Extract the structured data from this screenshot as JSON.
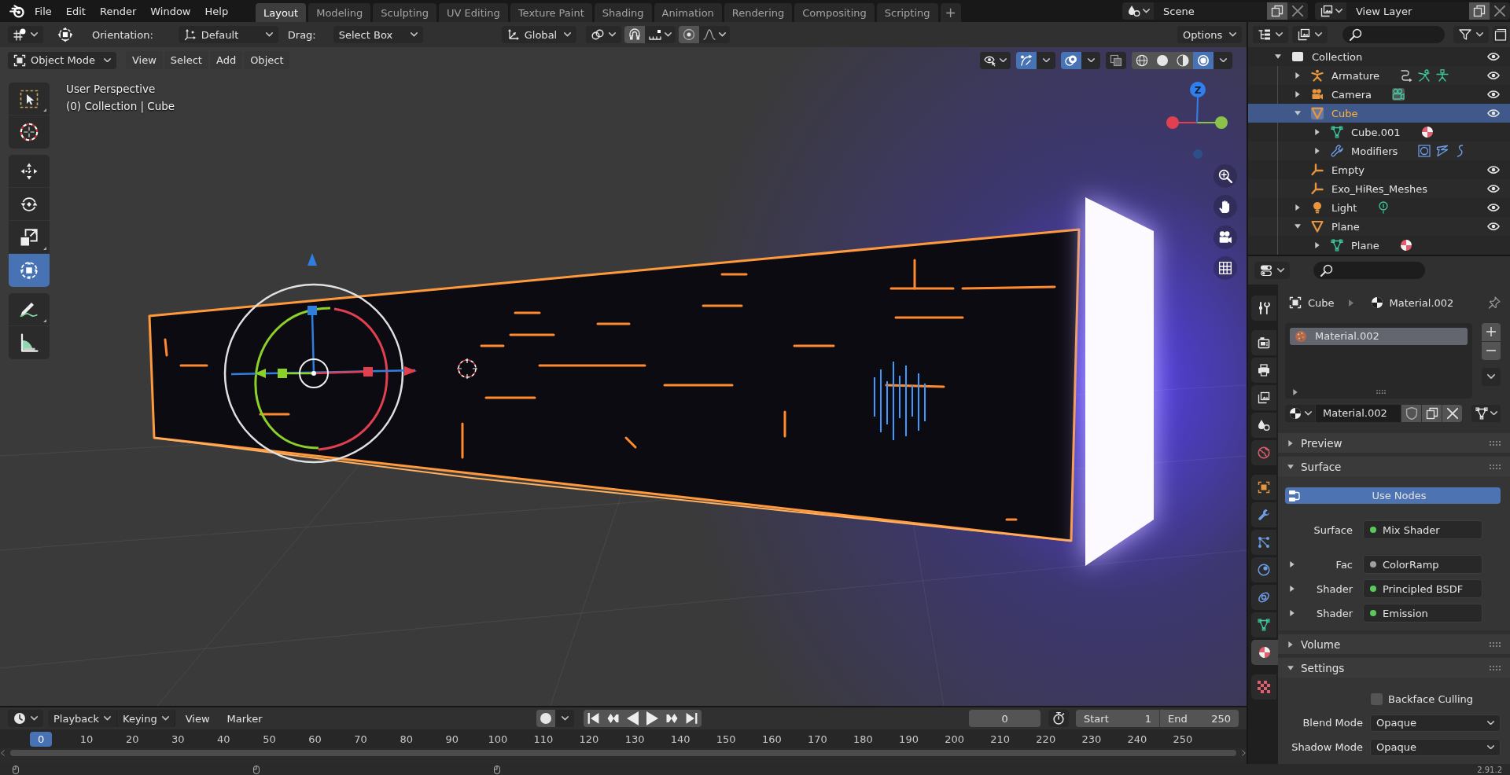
{
  "topbar": {
    "menus": [
      "File",
      "Edit",
      "Render",
      "Window",
      "Help"
    ],
    "workspaces": [
      {
        "label": "Layout",
        "selected": true
      },
      {
        "label": "Modeling",
        "selected": false
      },
      {
        "label": "Sculpting",
        "selected": false
      },
      {
        "label": "UV Editing",
        "selected": false
      },
      {
        "label": "Texture Paint",
        "selected": false
      },
      {
        "label": "Shading",
        "selected": false
      },
      {
        "label": "Animation",
        "selected": false
      },
      {
        "label": "Rendering",
        "selected": false
      },
      {
        "label": "Compositing",
        "selected": false
      },
      {
        "label": "Scripting",
        "selected": false
      }
    ],
    "add_workspace": "+",
    "scene": "Scene",
    "view_layer": "View Layer"
  },
  "tool_settings": {
    "orientation_label": "Orientation:",
    "orientation": "Default",
    "drag_label": "Drag:",
    "drag": "Select Box",
    "transform_orientation": "Global",
    "snap": false,
    "proportional_editing": false,
    "options": "Options"
  },
  "viewport": {
    "mode": "Object Mode",
    "menus": [
      "View",
      "Select",
      "Add",
      "Object"
    ],
    "show_gizmos": true,
    "show_overlays": true,
    "xray": false,
    "shading": [
      {
        "kind": "wireframe",
        "selected": false
      },
      {
        "kind": "solid",
        "selected": false
      },
      {
        "kind": "material",
        "selected": false
      },
      {
        "kind": "rendered",
        "selected": true
      }
    ],
    "tool_groups": [
      {
        "tools": [
          {
            "kind": "select-box",
            "selected": false
          },
          {
            "kind": "cursor",
            "selected": false
          }
        ]
      },
      {
        "tools": [
          {
            "kind": "move",
            "selected": false
          },
          {
            "kind": "rotate",
            "selected": false
          },
          {
            "kind": "scale",
            "selected": false
          },
          {
            "kind": "transform",
            "selected": true
          }
        ]
      },
      {
        "tools": [
          {
            "kind": "annotate",
            "selected": false
          },
          {
            "kind": "measure",
            "selected": false
          }
        ]
      }
    ],
    "view_name": "User Perspective",
    "context": "(0) Collection | Cube",
    "nav_axis_label": "Z"
  },
  "outliner": {
    "tree": [
      {
        "label": "Collection",
        "kind": "collection",
        "expanded": true,
        "selected": false,
        "visible": true,
        "children": [
          {
            "label": "Armature",
            "kind": "armature",
            "expanded": false,
            "selected": false,
            "visible": true
          },
          {
            "label": "Camera",
            "kind": "camera",
            "expanded": false,
            "selected": false,
            "visible": true
          },
          {
            "label": "Cube",
            "kind": "mesh-object",
            "expanded": true,
            "selected": true,
            "visible": true,
            "children": [
              {
                "label": "Cube.001",
                "kind": "mesh-data",
                "expanded": false,
                "selected": false
              },
              {
                "label": "Modifiers",
                "kind": "modifiers",
                "expanded": false,
                "selected": false
              }
            ]
          },
          {
            "label": "Empty",
            "kind": "empty",
            "selected": false,
            "visible": true
          },
          {
            "label": "Exo_HiRes_Meshes",
            "kind": "empty",
            "selected": false,
            "visible": true
          },
          {
            "label": "Light",
            "kind": "light",
            "expanded": false,
            "selected": false,
            "visible": true
          },
          {
            "label": "Plane",
            "kind": "mesh-object",
            "expanded": true,
            "selected": false,
            "visible": true,
            "children": [
              {
                "label": "Plane",
                "kind": "mesh-data",
                "expanded": false,
                "selected": false
              }
            ]
          }
        ]
      }
    ]
  },
  "properties": {
    "tab_groups": [
      {
        "tabs": [
          {
            "kind": "tool",
            "selected": false
          }
        ]
      },
      {
        "tabs": [
          {
            "kind": "render",
            "selected": false
          },
          {
            "kind": "output",
            "selected": false
          },
          {
            "kind": "view-layer",
            "selected": false
          },
          {
            "kind": "scene",
            "selected": false
          },
          {
            "kind": "world",
            "selected": false
          }
        ]
      },
      {
        "tabs": [
          {
            "kind": "object",
            "selected": false
          },
          {
            "kind": "modifiers",
            "selected": false
          },
          {
            "kind": "particles",
            "selected": false
          },
          {
            "kind": "physics",
            "selected": false
          },
          {
            "kind": "constraints",
            "selected": false
          },
          {
            "kind": "data",
            "selected": false
          },
          {
            "kind": "material",
            "selected": true
          }
        ]
      },
      {
        "tabs": [
          {
            "kind": "texture",
            "selected": false
          }
        ]
      }
    ],
    "context_path": [
      {
        "kind": "object",
        "label": "Cube"
      },
      {
        "kind": "material",
        "label": "Material.002"
      }
    ],
    "material_slots": [
      {
        "label": "Material.002",
        "selected": true
      }
    ],
    "material_name": "Material.002",
    "panels": [
      {
        "title": "Preview",
        "expanded": false
      },
      {
        "title": "Surface",
        "expanded": true,
        "rows": [
          {
            "kind": "toggle-button",
            "label": "Use Nodes",
            "on": true
          },
          {
            "kind": "socket",
            "label": "Surface",
            "value": "Mix Shader",
            "color": "#5cc85c"
          },
          {
            "kind": "socket",
            "label": "Fac",
            "value": "ColorRamp",
            "color": "#a1a1a1",
            "expanded": false
          },
          {
            "kind": "socket",
            "label": "Shader",
            "value": "Principled BSDF",
            "color": "#5cc85c",
            "expanded": false
          },
          {
            "kind": "socket",
            "label": "Shader",
            "value": "Emission",
            "color": "#5cc85c",
            "expanded": false
          }
        ]
      },
      {
        "title": "Volume",
        "expanded": false
      },
      {
        "title": "Settings",
        "expanded": true,
        "rows": [
          {
            "kind": "checkbox",
            "label": "Backface Culling",
            "checked": false
          },
          {
            "kind": "dropdown",
            "label": "Blend Mode",
            "value": "Opaque"
          },
          {
            "kind": "dropdown",
            "label": "Shadow Mode",
            "value": "Opaque"
          }
        ]
      }
    ]
  },
  "timeline": {
    "menus": [
      {
        "label": "Playback",
        "kind": "dropdown"
      },
      {
        "label": "Keying",
        "kind": "dropdown"
      },
      {
        "label": "View",
        "kind": "menu"
      },
      {
        "label": "Marker",
        "kind": "menu"
      }
    ],
    "auto_keying": false,
    "current_frame": "0",
    "use_preview_range": false,
    "start_label": "Start",
    "start": "1",
    "end_label": "End",
    "end": "250",
    "ruler": [
      {
        "label": "0",
        "selected": true
      },
      {
        "label": "10",
        "selected": false
      },
      {
        "label": "20",
        "selected": false
      },
      {
        "label": "30",
        "selected": false
      },
      {
        "label": "40",
        "selected": false
      },
      {
        "label": "50",
        "selected": false
      },
      {
        "label": "60",
        "selected": false
      },
      {
        "label": "70",
        "selected": false
      },
      {
        "label": "80",
        "selected": false
      },
      {
        "label": "90",
        "selected": false
      },
      {
        "label": "100",
        "selected": false
      },
      {
        "label": "110",
        "selected": false
      },
      {
        "label": "120",
        "selected": false
      },
      {
        "label": "130",
        "selected": false
      },
      {
        "label": "140",
        "selected": false
      },
      {
        "label": "150",
        "selected": false
      },
      {
        "label": "160",
        "selected": false
      },
      {
        "label": "170",
        "selected": false
      },
      {
        "label": "180",
        "selected": false
      },
      {
        "label": "190",
        "selected": false
      },
      {
        "label": "200",
        "selected": false
      },
      {
        "label": "210",
        "selected": false
      },
      {
        "label": "220",
        "selected": false
      },
      {
        "label": "230",
        "selected": false
      },
      {
        "label": "240",
        "selected": false
      },
      {
        "label": "250",
        "selected": false
      }
    ]
  },
  "status_bar": {
    "version": "2.91.2"
  }
}
